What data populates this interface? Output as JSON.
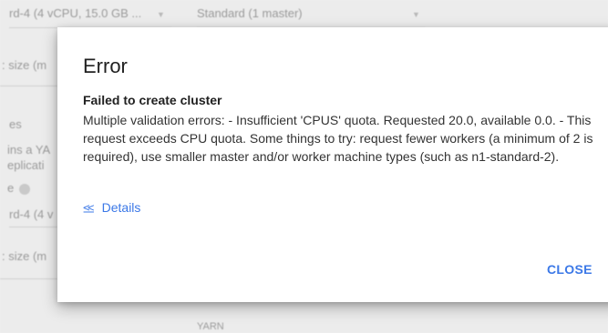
{
  "background": {
    "machine_type_1": "rd-4 (4 vCPU, 15.0 GB ...",
    "cluster_mode": "Standard (1 master)",
    "disk_size_1": ": size (m",
    "label_es": "es",
    "contains_yaml": "ins a YA",
    "application": "eplicati",
    "label_e": "e",
    "machine_type_2": "rd-4 (4 v",
    "disk_size_2": ": size (m",
    "bottom_fragment": "YARN"
  },
  "dialog": {
    "title": "Error",
    "subtitle": "Failed to create cluster",
    "message": "Multiple validation errors: - Insufficient 'CPUS' quota. Requested 20.0, available 0.0. - This request exceeds CPU quota. Some things to try: request fewer workers (a minimum of 2 is required), use smaller master and/or worker machine types (such as n1-standard-2).",
    "details_label": "Details",
    "close_label": "CLOSE"
  },
  "colors": {
    "link": "#3b78e7",
    "text": "#212121"
  }
}
